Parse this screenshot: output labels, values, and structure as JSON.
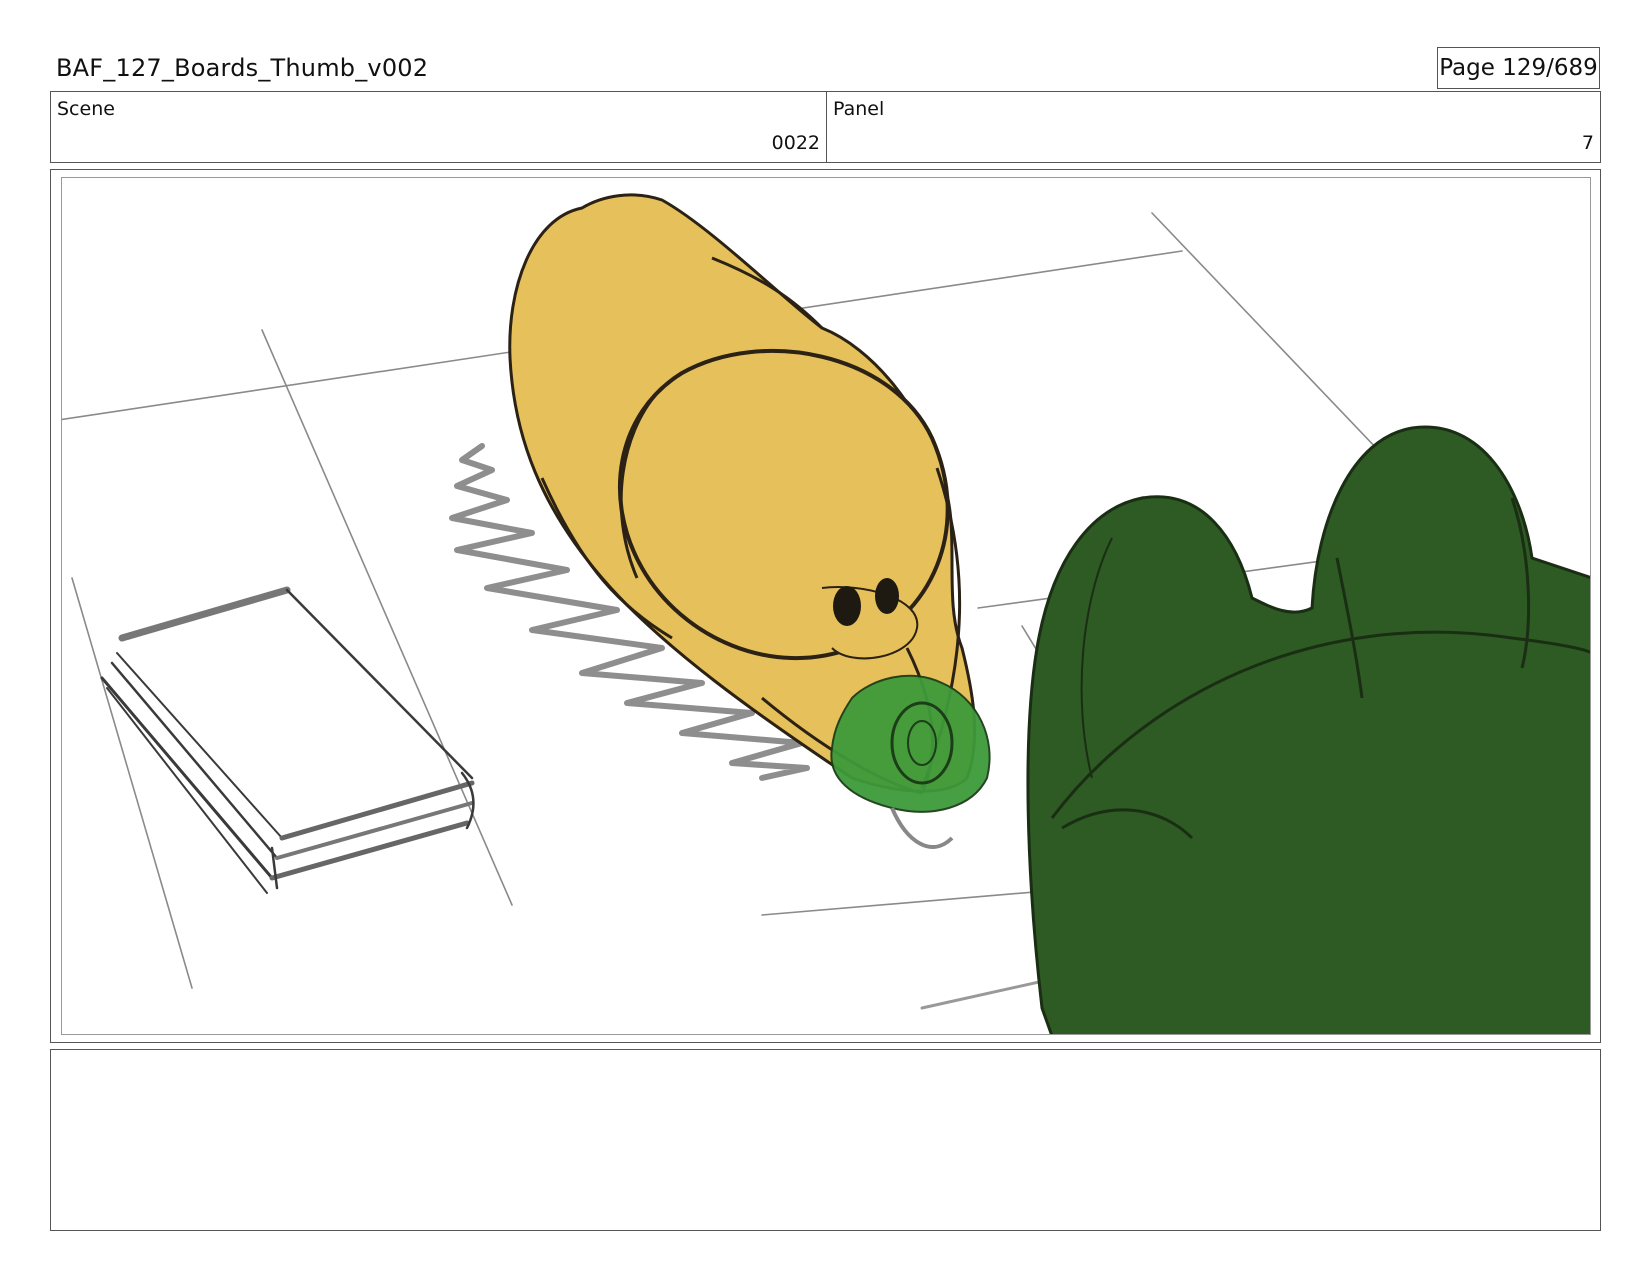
{
  "header": {
    "document_title": "BAF_127_Boards_Thumb_v002",
    "page_label": "Page 129/689"
  },
  "info": {
    "scene_label": "Scene",
    "scene_value": "0022",
    "panel_label": "Panel",
    "panel_value": "7"
  },
  "artwork": {
    "description_icon": "storyboard-sketch",
    "colors": {
      "yellow_character": "#E6C05A",
      "green_foreground": "#2E5A24",
      "bright_green_object": "#3E9A3A",
      "pencil": "#555555"
    }
  },
  "notes": {
    "text": ""
  }
}
